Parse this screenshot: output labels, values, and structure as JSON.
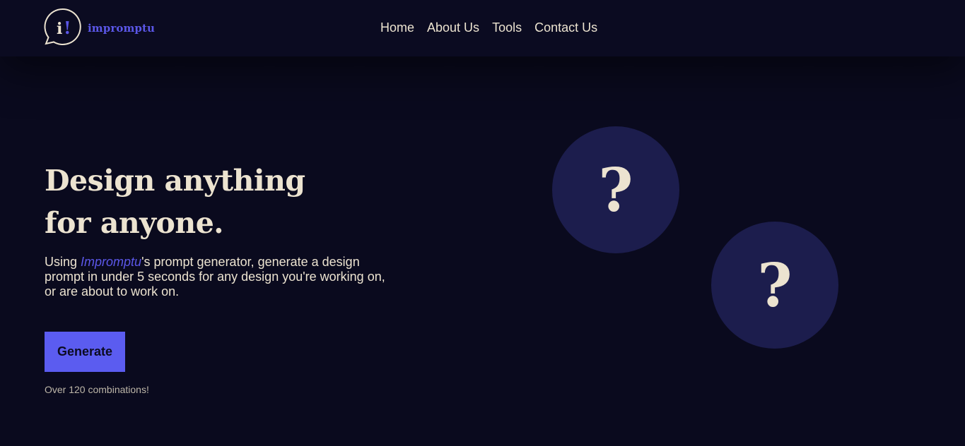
{
  "brand": {
    "name": "impromptu",
    "mark_glyph": "i!",
    "color": "#5b57e8"
  },
  "nav": {
    "items": [
      {
        "label": "Home"
      },
      {
        "label": "About Us"
      },
      {
        "label": "Tools"
      },
      {
        "label": "Contact Us"
      }
    ]
  },
  "hero": {
    "title_line1": "Design anything",
    "title_line2": "for anyone.",
    "desc_prefix": "Using ",
    "desc_brand": "Impromptu",
    "desc_suffix": "'s prompt generator, generate a design prompt in under 5 seconds for any design you're working on, or are about to work on.",
    "button_label": "Generate",
    "combos_text": "Over 120 combinations!"
  },
  "cards": [
    {
      "symbol": "?"
    },
    {
      "symbol": "?"
    }
  ],
  "colors": {
    "background": "#0a0a1e",
    "navbar": "#0b0b21",
    "accent": "#5b5cf0",
    "text": "#ece3d0",
    "circle": "#1c1d4d"
  }
}
